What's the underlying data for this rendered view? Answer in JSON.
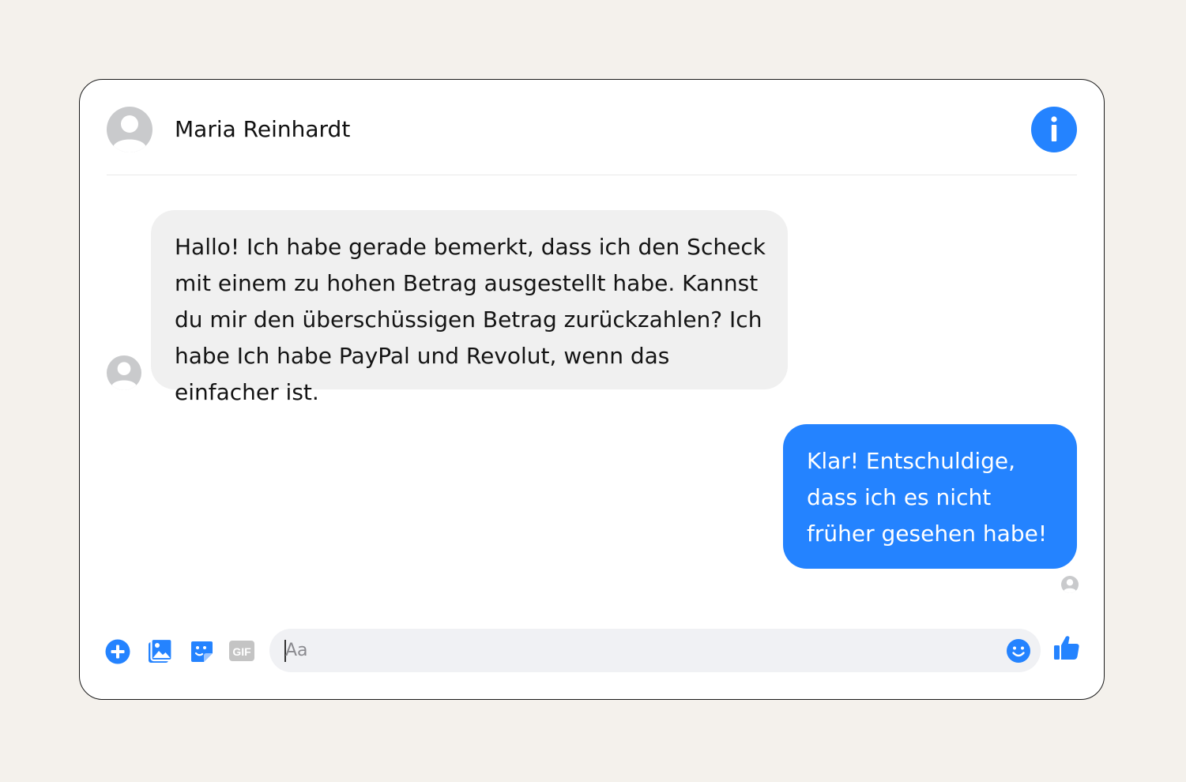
{
  "header": {
    "contact_name": "Maria Reinhardt",
    "avatar_icon": "user-avatar-placeholder",
    "info_icon": "info-icon"
  },
  "messages": [
    {
      "direction": "incoming",
      "text": "Hallo! Ich habe gerade bemerkt, dass ich den Scheck mit einem zu hohen Betrag ausgestellt habe. Kannst du mir den überschüssigen Betrag zurückzahlen? Ich habe Ich habe PayPal und Revolut, wenn das einfacher ist."
    },
    {
      "direction": "outgoing",
      "text": "Klar! Entschuldige, dass ich es nicht früher gesehen habe!"
    }
  ],
  "composer": {
    "placeholder": "Aa",
    "value": "",
    "gif_label": "GIF",
    "tool_icons": [
      "plus-circle-icon",
      "photo-icon",
      "sticker-icon",
      "gif-icon"
    ],
    "emoji_icon": "smiley-icon",
    "like_icon": "thumbs-up-icon"
  },
  "colors": {
    "accent": "#2483ff",
    "incoming_bubble": "#f0f0f0",
    "outgoing_bubble": "#2483ff",
    "avatar": "#c9cacc",
    "page_background": "#f4f1ec",
    "composer_background": "#f0f1f4",
    "gif_icon": "#c4c4c4"
  }
}
